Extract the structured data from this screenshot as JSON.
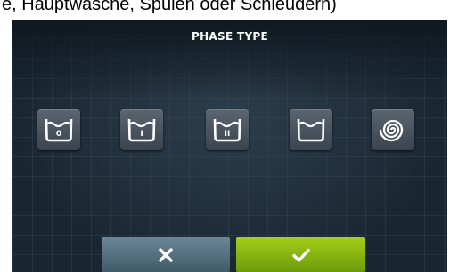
{
  "caption": "e, Hauptwäsche, Spülen oder Schleudern)",
  "screen": {
    "title": "PHASE TYPE",
    "phases": [
      {
        "label": "0",
        "icon": "prewash-basin-icon"
      },
      {
        "label": "I",
        "icon": "main-wash-basin-icon"
      },
      {
        "label": "II",
        "icon": "second-wash-basin-icon"
      },
      {
        "label": "",
        "icon": "rinse-basin-icon"
      },
      {
        "label": "",
        "icon": "spin-spiral-icon"
      }
    ],
    "buttons": {
      "cancel_icon": "close-icon",
      "confirm_icon": "checkmark-icon"
    }
  },
  "colors": {
    "screen_bg": "#1a2733",
    "phase_button": "#4a545e",
    "cancel_button": "#56717f",
    "confirm_button": "#8bb514"
  }
}
